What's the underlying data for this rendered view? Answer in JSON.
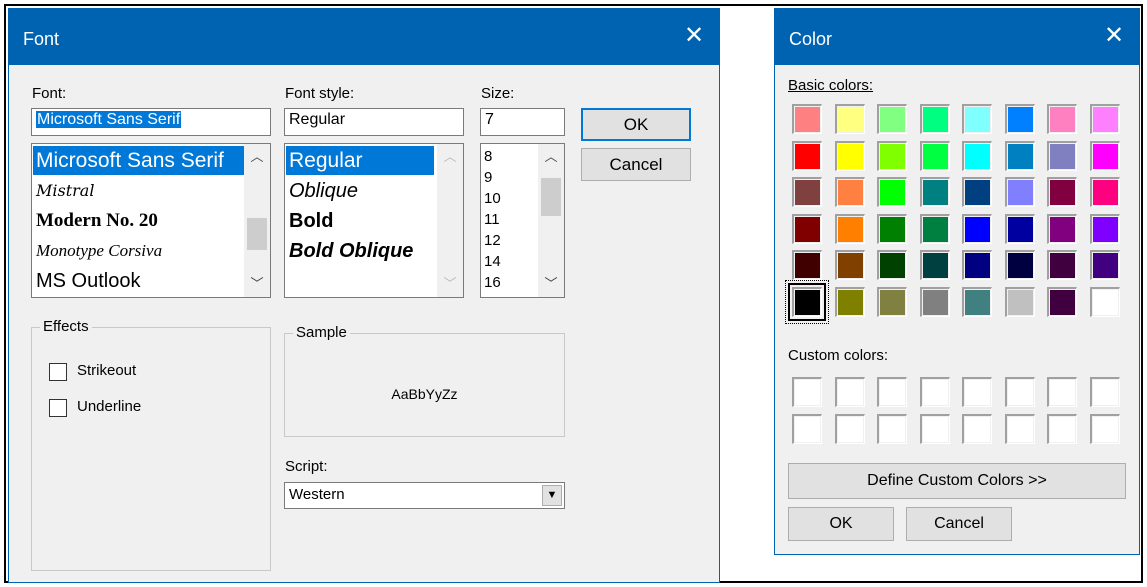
{
  "font_dialog": {
    "title": "Font",
    "close_glyph": "✕",
    "font_label": "Font:",
    "font_value": "Microsoft Sans Serif",
    "font_list": [
      "Microsoft Sans Serif",
      "Mistral",
      "Modern No. 20",
      "Monotype Corsiva",
      "MS Outlook"
    ],
    "style_label": "Font style:",
    "style_value": "Regular",
    "style_list": [
      "Regular",
      "Oblique",
      "Bold",
      "Bold Oblique"
    ],
    "size_label": "Size:",
    "size_value": "7",
    "size_list": [
      "8",
      "9",
      "10",
      "11",
      "12",
      "14",
      "16"
    ],
    "ok_label": "OK",
    "cancel_label": "Cancel",
    "effects_label": "Effects",
    "strikeout_label": "Strikeout",
    "underline_label": "Underline",
    "sample_label": "Sample",
    "sample_text": "AaBbYyZz",
    "script_label": "Script:",
    "script_value": "Western",
    "selected_color": "#0078d7"
  },
  "color_dialog": {
    "title": "Color",
    "close_glyph": "✕",
    "basic_label": "Basic colors:",
    "custom_label": "Custom colors:",
    "define_label": "Define Custom Colors >>",
    "ok_label": "OK",
    "cancel_label": "Cancel",
    "basic_colors": [
      [
        "#ff8080",
        "#ffff80",
        "#80ff80",
        "#00ff80",
        "#80ffff",
        "#0080ff",
        "#ff80c0",
        "#ff80ff"
      ],
      [
        "#ff0000",
        "#ffff00",
        "#80ff00",
        "#00ff40",
        "#00ffff",
        "#0080c0",
        "#8080c0",
        "#ff00ff"
      ],
      [
        "#804040",
        "#ff8040",
        "#00ff00",
        "#008080",
        "#004080",
        "#8080ff",
        "#800040",
        "#ff0080"
      ],
      [
        "#800000",
        "#ff8000",
        "#008000",
        "#008040",
        "#0000ff",
        "#0000a0",
        "#800080",
        "#8000ff"
      ],
      [
        "#400000",
        "#804000",
        "#004000",
        "#004040",
        "#000080",
        "#000040",
        "#400040",
        "#400080"
      ],
      [
        "#000000",
        "#808000",
        "#808040",
        "#808080",
        "#408080",
        "#c0c0c0",
        "#400040",
        "#ffffff"
      ]
    ]
  }
}
